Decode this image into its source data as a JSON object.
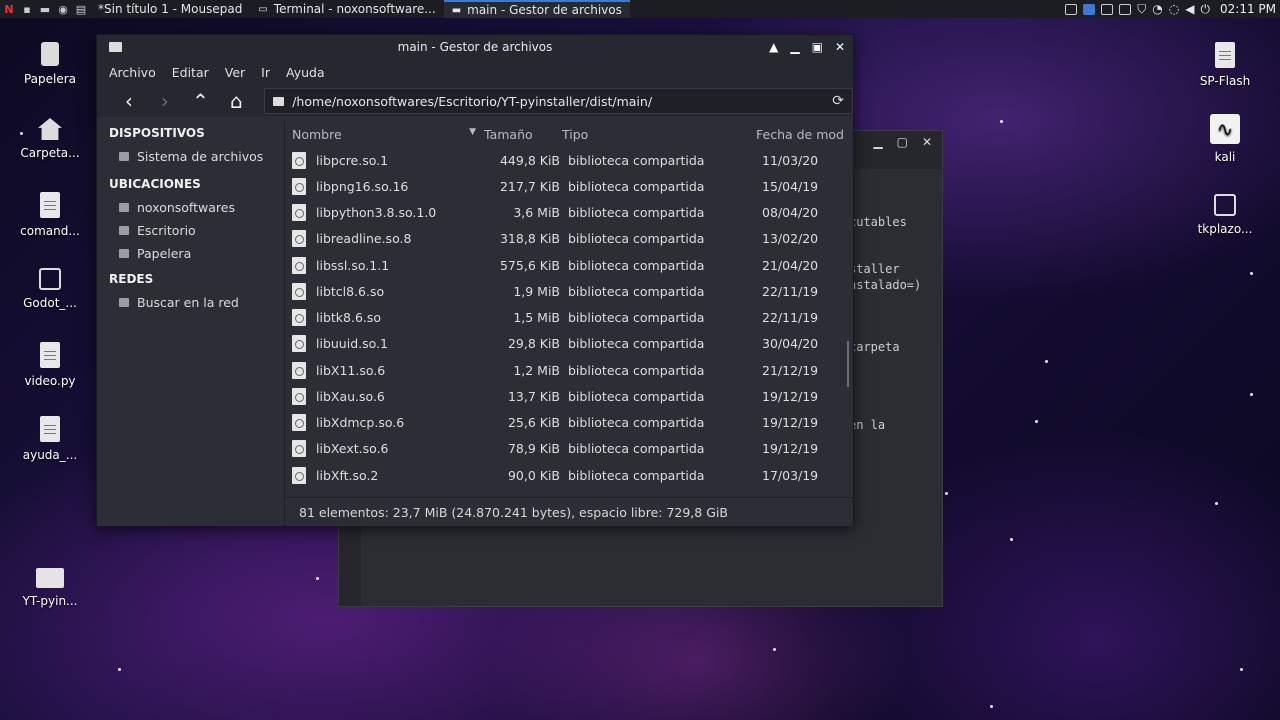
{
  "top_panel": {
    "tasks": [
      {
        "label": "*Sin título 1 - Mousepad"
      },
      {
        "label": "Terminal - noxonsoftware..."
      },
      {
        "label": "main - Gestor de archivos"
      }
    ],
    "clock": "02:11 PM"
  },
  "desktop": {
    "icons_left": [
      {
        "label": "Papelera",
        "icon": "trash-icon"
      },
      {
        "label": "Carpeta...",
        "icon": "home-folder-icon"
      },
      {
        "label": "comand...",
        "icon": "text-file-icon"
      },
      {
        "label": "Godot_...",
        "icon": "executable-icon"
      },
      {
        "label": "video.py",
        "icon": "python-file-icon"
      },
      {
        "label": "ayuda_...",
        "icon": "text-file-icon"
      },
      {
        "label": "YT-pyin...",
        "icon": "folder-icon"
      }
    ],
    "icons_right": [
      {
        "label": "SP-Flash",
        "icon": "file-icon"
      },
      {
        "label": "kali",
        "icon": "kali-icon"
      },
      {
        "label": "tkplazo...",
        "icon": "executable-icon"
      }
    ]
  },
  "terminal": {
    "lines": [
      "cutables",
      "staller",
      "nstalado=)",
      "carpeta",
      "en la"
    ]
  },
  "file_manager": {
    "title": "main - Gestor de archivos",
    "menu": [
      "Archivo",
      "Editar",
      "Ver",
      "Ir",
      "Ayuda"
    ],
    "path": "/home/noxonsoftwares/Escritorio/YT-pyinstaller/dist/main/",
    "sidebar": {
      "sections": [
        {
          "heading": "DISPOSITIVOS",
          "items": [
            "Sistema de archivos"
          ]
        },
        {
          "heading": "UBICACIONES",
          "items": [
            "noxonsoftwares",
            "Escritorio",
            "Papelera"
          ]
        },
        {
          "heading": "REDES",
          "items": [
            "Buscar en la red"
          ]
        }
      ]
    },
    "columns": {
      "name": "Nombre",
      "size": "Tamaño",
      "type": "Tipo",
      "date": "Fecha de mod"
    },
    "files": [
      {
        "name": "libpcre.so.1",
        "size": "449,8 KiB",
        "type": "biblioteca compartida",
        "date": "11/03/20"
      },
      {
        "name": "libpng16.so.16",
        "size": "217,7 KiB",
        "type": "biblioteca compartida",
        "date": "15/04/19"
      },
      {
        "name": "libpython3.8.so.1.0",
        "size": "3,6 MiB",
        "type": "biblioteca compartida",
        "date": "08/04/20"
      },
      {
        "name": "libreadline.so.8",
        "size": "318,8 KiB",
        "type": "biblioteca compartida",
        "date": "13/02/20"
      },
      {
        "name": "libssl.so.1.1",
        "size": "575,6 KiB",
        "type": "biblioteca compartida",
        "date": "21/04/20"
      },
      {
        "name": "libtcl8.6.so",
        "size": "1,9 MiB",
        "type": "biblioteca compartida",
        "date": "22/11/19"
      },
      {
        "name": "libtk8.6.so",
        "size": "1,5 MiB",
        "type": "biblioteca compartida",
        "date": "22/11/19"
      },
      {
        "name": "libuuid.so.1",
        "size": "29,8 KiB",
        "type": "biblioteca compartida",
        "date": "30/04/20"
      },
      {
        "name": "libX11.so.6",
        "size": "1,2 MiB",
        "type": "biblioteca compartida",
        "date": "21/12/19"
      },
      {
        "name": "libXau.so.6",
        "size": "13,7 KiB",
        "type": "biblioteca compartida",
        "date": "19/12/19"
      },
      {
        "name": "libXdmcp.so.6",
        "size": "25,6 KiB",
        "type": "biblioteca compartida",
        "date": "19/12/19"
      },
      {
        "name": "libXext.so.6",
        "size": "78,9 KiB",
        "type": "biblioteca compartida",
        "date": "19/12/19"
      },
      {
        "name": "libXft.so.2",
        "size": "90,0 KiB",
        "type": "biblioteca compartida",
        "date": "17/03/19"
      }
    ],
    "status": "81 elementos: 23,7 MiB (24.870.241 bytes), espacio libre: 729,8 GiB"
  }
}
